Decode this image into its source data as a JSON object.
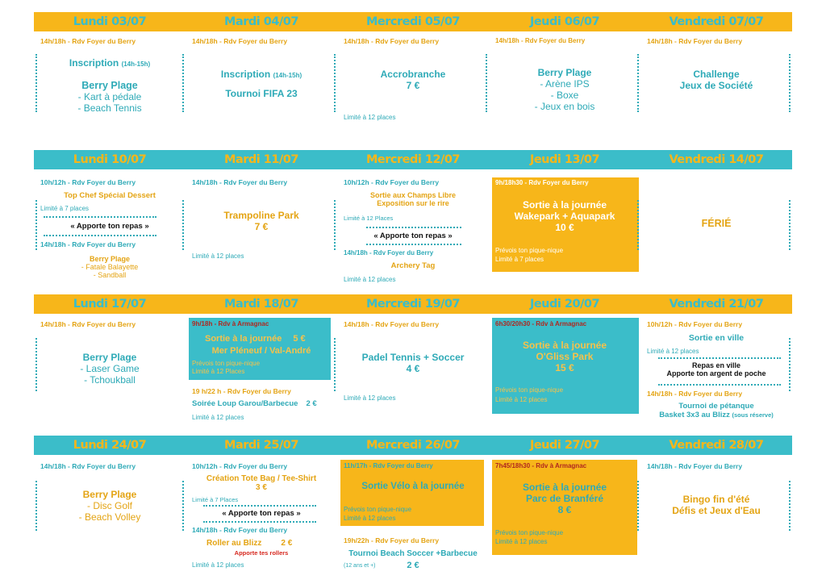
{
  "week1": {
    "days": [
      "Lundi 03/07",
      "Mardi 04/07",
      "Mercredi 05/07",
      "Jeudi 06/07",
      "Vendredi 07/07"
    ],
    "mon": {
      "rdv": "14h/18h - Rdv Foyer du Berry",
      "l1": "Inscription",
      "l1s": "(14h-15h)",
      "l2": "Berry Plage",
      "l3": "- Kart à pédale",
      "l4": "- Beach Tennis"
    },
    "tue": {
      "rdv": "14h/18h - Rdv Foyer du Berry",
      "l1": "Inscription",
      "l1s": "(14h-15h)",
      "l2": "Tournoi FIFA 23"
    },
    "wed": {
      "rdv": "14h/18h - Rdv Foyer du Berry",
      "l1": "Accrobranche",
      "l2": "7 €",
      "limit": "Limité à 12 places"
    },
    "thu": {
      "rdv": "14h/18h - Rdv Foyer du Berry",
      "l1": "Berry Plage",
      "l2": "- Arène IPS",
      "l3": "- Boxe",
      "l4": "- Jeux en bois"
    },
    "fri": {
      "rdv": "14h/18h - Rdv Foyer du Berry",
      "l1": "Challenge",
      "l2": "Jeux de Société"
    }
  },
  "week2": {
    "days": [
      "Lundi 10/07",
      "Mardi 11/07",
      "Mercredi 12/07",
      "Jeudi 13/07",
      "Vendredi 14/07"
    ],
    "mon": {
      "rdv1": "10h/12h - Rdv Foyer du Berry",
      "a1": "Top Chef Spécial Dessert",
      "limit1": "Limité à 7 places",
      "meal": "« Apporte ton repas »",
      "rdv2": "14h/18h - Rdv Foyer du Berry",
      "a2": "Berry Plage",
      "a3": "- Fatale Balayette",
      "a4": "- Sandball"
    },
    "tue": {
      "rdv": "14h/18h - Rdv Foyer du Berry",
      "l1": "Trampoline Park",
      "l2": "7 €",
      "limit": "Limité à 12 places"
    },
    "wed": {
      "rdv1": "10h/12h - Rdv Foyer du Berry",
      "a1": "Sortie aux Champs Libre",
      "a2": "Exposition sur le rire",
      "limit1": "Limité à 12 Places",
      "meal": "« Apporte ton repas »",
      "rdv2": "14h/18h - Rdv Foyer du Berry",
      "a3": "Archery Tag",
      "limit2": "Limité à 12 places"
    },
    "thu": {
      "rdv": "9h/18h30 - Rdv Foyer du Berry",
      "l1": "Sortie à la journée",
      "l2": "Wakepark + Aquapark",
      "l3": "10 €",
      "n1": "Prévois ton pique-nique",
      "n2": "Limité à 7 places"
    },
    "fri": {
      "l1": "FÉRIÉ"
    }
  },
  "week3": {
    "days": [
      "Lundi 17/07",
      "Mardi 18/07",
      "Mercredi 19/07",
      "Jeudi 20/07",
      "Vendredi 21/07"
    ],
    "mon": {
      "rdv": "14h/18h - Rdv Foyer du Berry",
      "l1": "Berry Plage",
      "l2": "- Laser Game",
      "l3": "- Tchoukball"
    },
    "tue": {
      "rdv1": "9h/18h - Rdv à Armagnac",
      "a1": "Sortie à la journée",
      "a1p": "5 €",
      "a2": "Mer Pléneuf / Val-André",
      "n1": "Prévois ton pique-nique",
      "n2": "Limité à 12 Places",
      "rdv2": "19 h/22 h - Rdv Foyer du Berry",
      "a3": "Soirée Loup Garou/Barbecue",
      "a3p": "2 €",
      "limit": "Limité à 12 places"
    },
    "wed": {
      "rdv": "14h/18h - Rdv Foyer du Berry",
      "l1": "Padel Tennis + Soccer",
      "l2": "4 €",
      "limit": "Limité à 12 places"
    },
    "thu": {
      "rdv": "6h30/20h30 - Rdv à Armagnac",
      "l1": "Sortie à la journée",
      "l2": "O'Gliss Park",
      "l3": "15 €",
      "n1": "Prévois ton pique-nique",
      "n2": "Limité à 12 places"
    },
    "fri": {
      "rdv1": "10h/12h - Rdv Foyer du Berry",
      "a1": "Sortie en ville",
      "limit1": "Limité à 12 places",
      "m1": "Repas en ville",
      "m2": "Apporte ton argent de poche",
      "rdv2": "14h/18h - Rdv Foyer du Berry",
      "a2": "Tournoi de pétanque",
      "a3": "Basket 3x3 au Blizz",
      "a3s": "(sous réserve)"
    }
  },
  "week4": {
    "days": [
      "Lundi 24/07",
      "Mardi 25/07",
      "Mercredi 26/07",
      "Jeudi 27/07",
      "Vendredi 28/07"
    ],
    "mon": {
      "rdv": "14h/18h - Rdv Foyer du Berry",
      "l1": "Berry Plage",
      "l2": "- Disc Golf",
      "l3": "- Beach Volley"
    },
    "tue": {
      "rdv1": "10h/12h - Rdv Foyer du Berry",
      "a1": "Création Tote Bag / Tee-Shirt",
      "a1p": "3 €",
      "limit1": "Limité à 7 Places",
      "meal": "« Apporte ton repas »",
      "rdv2": "14h/18h - Rdv Foyer du Berry",
      "a2": "Roller au Blizz",
      "a2p": "2 €",
      "a2n": "Apporte tes rollers",
      "limit2": "Limité à 12 places"
    },
    "wed": {
      "rdv1": "11h/17h - Rdv Foyer du Berry",
      "a1": "Sortie Vélo à la journée",
      "n1": "Prévois ton pique-nique",
      "n2": "Limité à 12 places",
      "rdv2": "19h/22h - Rdv Foyer du Berry",
      "a2": "Tournoi Beach Soccer +Barbecue",
      "a2s": "(12 ans et +)",
      "a2p": "2 €"
    },
    "thu": {
      "rdv": "7h45/18h30 - Rdv à Armagnac",
      "l1": "Sortie à la journée",
      "l2": "Parc de Branféré",
      "l3": "8 €",
      "n1": "Prévois ton pique-nique",
      "n2": "Limité à 12 places"
    },
    "fri": {
      "rdv": "14h/18h - Rdv Foyer du Berry",
      "l1": "Bingo fin d'été",
      "l2": "Défis et Jeux d'Eau"
    }
  },
  "colors": {
    "orange": "#f7b61a",
    "teal": "#3bbdc9",
    "text_teal": "#2eaab7",
    "text_gold": "#e4a414"
  }
}
